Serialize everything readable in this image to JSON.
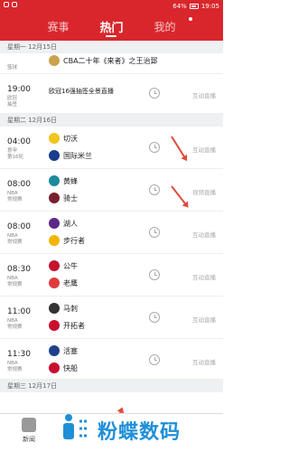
{
  "status_bar": {
    "battery": "64%",
    "time": "19:05"
  },
  "header": {
    "tabs": [
      {
        "label": "赛事"
      },
      {
        "label": "热门"
      },
      {
        "label": "我的"
      }
    ]
  },
  "dates": [
    "星期一  12月15日",
    "星期二  12月16日",
    "星期三  12月17日"
  ],
  "items": [
    {
      "time": "",
      "league": "篮球",
      "team1": "CBA二十年《来者》之王治郅",
      "team2": "",
      "live": ""
    },
    {
      "time": "19:00",
      "league": "欧冠\n抽签",
      "team1": "欧冠16强抽签全景直播",
      "team2": "",
      "live": "互动直播"
    },
    {
      "time": "04:00",
      "league": "意甲\n第16轮",
      "team1": "切沃",
      "team2": "国际米兰",
      "live": "互动直播"
    },
    {
      "time": "08:00",
      "league": "NBA\n常规赛",
      "team1": "黄蜂",
      "team2": "骑士",
      "live": "视频直播"
    },
    {
      "time": "08:00",
      "league": "NBA\n常规赛",
      "team1": "湖人",
      "team2": "步行者",
      "live": "互动直播"
    },
    {
      "time": "08:30",
      "league": "NBA\n常规赛",
      "team1": "公牛",
      "team2": "老鹰",
      "live": "互动直播"
    },
    {
      "time": "11:00",
      "league": "NBA\n常规赛",
      "team1": "马刺",
      "team2": "开拓者",
      "live": "互动直播"
    },
    {
      "time": "11:30",
      "league": "NBA\n常规赛",
      "team1": "活塞",
      "team2": "快船",
      "live": "互动直播"
    }
  ],
  "bottom_nav": {
    "news_label": "新闻"
  },
  "watermark": {
    "text": "粉蝶数码"
  },
  "colors": {
    "brand_red": "#d8262c",
    "annotation_red": "#e04a3a",
    "watermark_blue": "#1f8fd8"
  },
  "icons": {
    "alarm": "alarm-clock-icon",
    "news": "news-icon"
  }
}
